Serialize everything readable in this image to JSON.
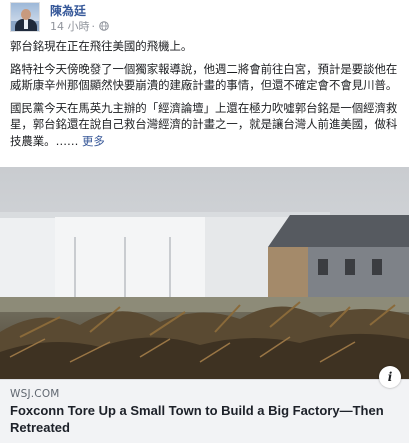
{
  "post": {
    "author": "陳為廷",
    "time": "14 小時",
    "paragraphs": [
      "郭台銘現在正在飛往美國的飛機上。",
      "路特社今天傍晚發了一個獨家報導說，他週二將會前往白宮，預計是要談他在威斯康辛州那個顯然快要崩潰的建廠計畫的事情，但還不確定會不會見川普。",
      "國民黨今天在馬英九主辦的「經濟論壇」上還在極力吹噓郭台銘是一個經濟救星，郭台銘還在說自己救台灣經濟的計畫之一，就是讓台灣人前進美國，做科技農業。……"
    ],
    "see_more": "更多"
  },
  "link_preview": {
    "domain": "WSJ.COM",
    "title": "Foxconn Tore Up a Small Town to Build a Big Factory—Then Retreated"
  },
  "icons": {
    "globe": "globe-icon",
    "more": "more-options-icon",
    "info": "info-icon"
  },
  "colors": {
    "author_link": "#365899",
    "see_more": "#385898",
    "link_box_bg": "#f2f3f5"
  }
}
